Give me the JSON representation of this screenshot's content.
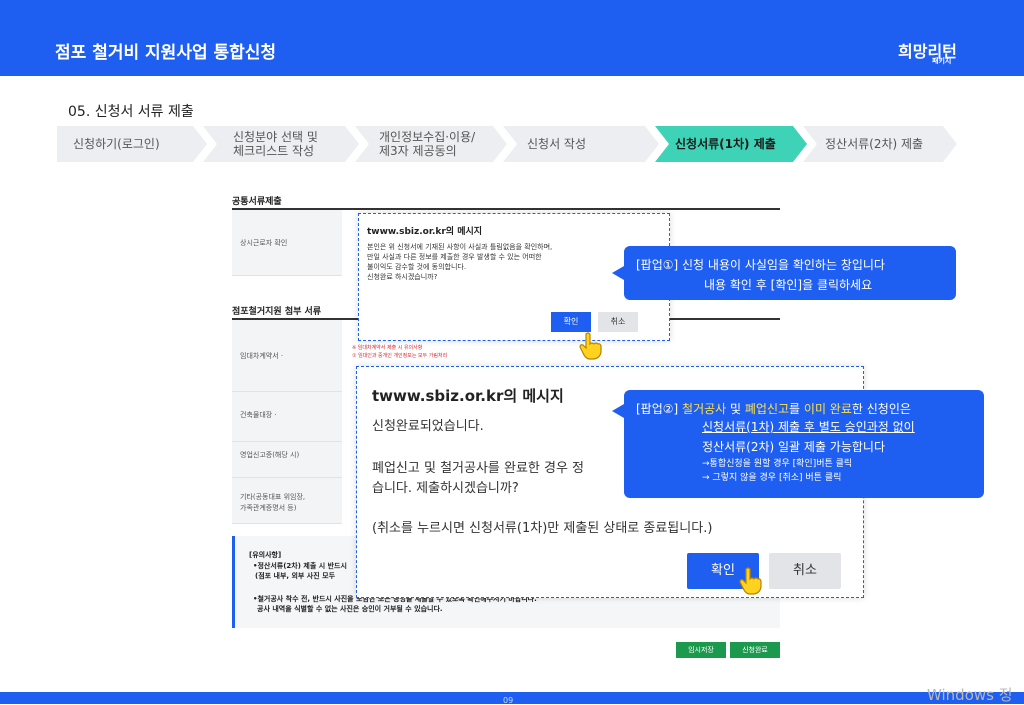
{
  "header": {
    "title": "점포 철거비 지원사업 통합신청",
    "logo_main": "희망리턴",
    "logo_sub": "패키지"
  },
  "section": {
    "title": "05. 신청서 서류 제출"
  },
  "steps": [
    {
      "line1": "신청하기(로그인)",
      "line2": ""
    },
    {
      "line1": "신청분야 선택 및",
      "line2": "체크리스트 작성"
    },
    {
      "line1": "개인정보수집·이용/",
      "line2": "제3자 제공동의"
    },
    {
      "line1": "신청서 작성",
      "line2": ""
    },
    {
      "line1": "신청서류(1차) 제출",
      "line2": ""
    },
    {
      "line1": "정산서류(2차) 제출",
      "line2": ""
    }
  ],
  "form": {
    "common_title": "공통서류제출",
    "row_regular": "상시근로자 확인",
    "attach_title": "점포철거지원 첨부 서류",
    "rows": [
      "임대차계약서 ·",
      "건축물대장 ·",
      "영업신고증(해당 시)",
      "기타(공동대표 위임장,",
      "가족관계증명서 등)"
    ],
    "red_notes": [
      "※ 임대차계약서 제출 시 유의사항",
      "① 임대인과 중개인 개인정보는 모두 가림처리"
    ],
    "notice_title": "[유의사항]",
    "notice_lines": [
      "•정산서류(2차) 제출 시 반드시",
      "(점포 내부, 외부 사진 모두",
      "•철거공사 착수 전, 반드시 사진을 포함한 모든 증빙을 제출할 수 있도록 확인해주시기 바랍니다.",
      "공사 내역을 식별할 수 없는 사진은 승인이 거부될 수 있습니다."
    ],
    "btn_temp": "임시저장",
    "btn_done": "신청완료"
  },
  "dialog1": {
    "title": "twww.sbiz.or.kr의 메시지",
    "body": "본인은 위 신청서에 기재된 사항이 사실과 틀림없음을 확인하며,\n만일 사실과 다른 정보를 제출한 경우 발생할 수 있는 어떠한\n불이익도 감수할 것에 동의합니다.\n신청완료 하시겠습니까?",
    "ok": "확인",
    "cancel": "취소"
  },
  "dialog2": {
    "title": "twww.sbiz.or.kr의 메시지",
    "line1": "신청완료되었습니다.",
    "line2": "폐업신고 및 철거공사를 완료한 경우 정",
    "line3": "습니다. 제출하시겠습니까?",
    "line4": "(취소를 누르시면 신청서류(1차)만 제출된 상태로 종료됩니다.)",
    "ok": "확인",
    "cancel": "취소"
  },
  "callout1": {
    "line1": "[팝업①]  신청 내용이 사실임을 확인하는 창입니다",
    "line2": "내용 확인 후 [확인]을 클릭하세요"
  },
  "callout2": {
    "prefix": "[팝업②]  ",
    "hl1": "철거공사",
    "mid1": " 및 ",
    "hl2": "폐업신고",
    "mid2": "를 ",
    "hl3": "이미 완료",
    "suffix": "한 신청인은",
    "line2": "신청서류(1차) 제출 후 별도 승인과정 없이",
    "line3": "정산서류(2차) 일괄 제출 가능합니다",
    "line4": "→통합신청을 원할 경우 [확인]버튼 클릭",
    "line5": "→ 그렇지 않을 경우 [취소] 버튼 클릭"
  },
  "footer": {
    "page": "09",
    "watermark": "Windows 정"
  },
  "colors": {
    "brand": "#1e5ef0",
    "active_step": "#3ed3b6",
    "highlight": "#ffe34a",
    "save_green": "#1b9a4e"
  }
}
